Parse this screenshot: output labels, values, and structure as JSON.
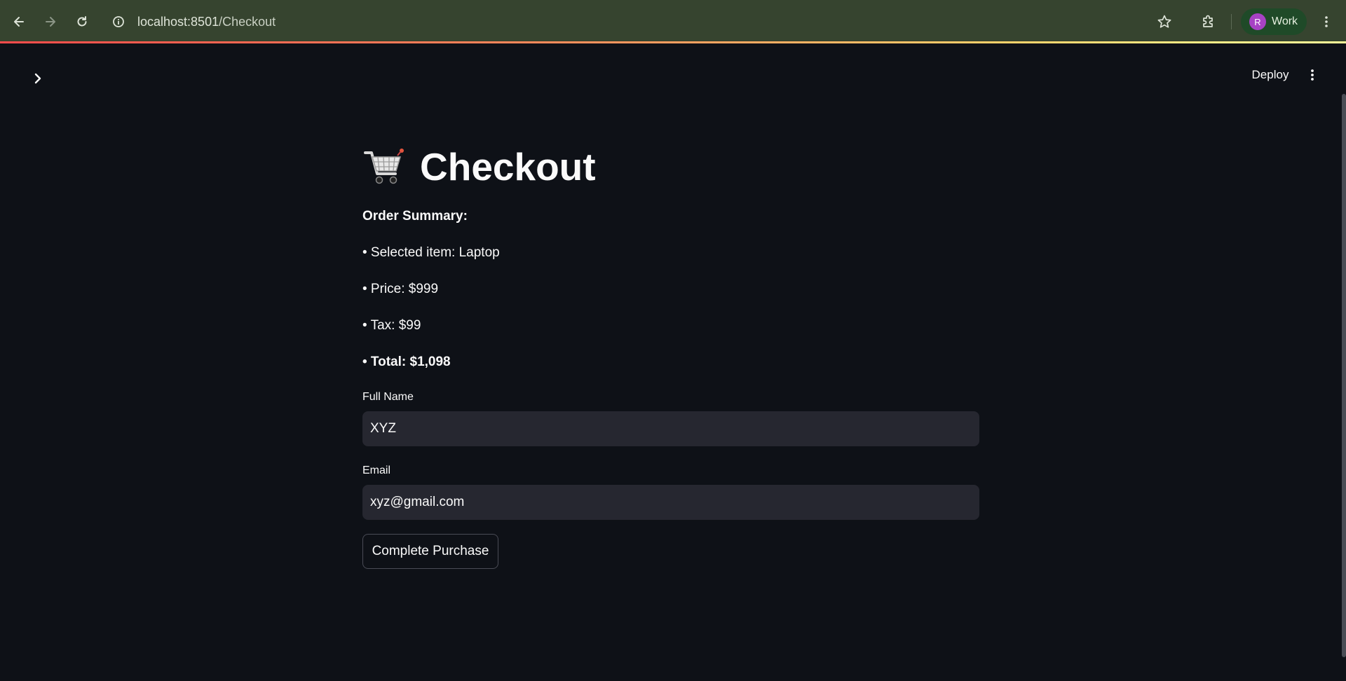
{
  "browser": {
    "url_host": "localhost:8501",
    "url_path": "/Checkout",
    "profile_initial": "R",
    "profile_label": "Work"
  },
  "header": {
    "deploy_label": "Deploy"
  },
  "main": {
    "title": "Checkout",
    "title_icon": "shopping-cart-icon",
    "summary_heading": "Order Summary:",
    "summary_items": [
      "• Selected item: Laptop",
      "• Price: $999",
      "• Tax: $99",
      "• Total: $1,098"
    ],
    "full_name_label": "Full Name",
    "full_name_value": "XYZ",
    "email_label": "Email",
    "email_value": "xyz@gmail.com",
    "purchase_button": "Complete Purchase"
  },
  "colors": {
    "background": "#0e1117",
    "input_bg": "#262730",
    "chrome_bg": "#36442f",
    "text": "#fafafa"
  }
}
